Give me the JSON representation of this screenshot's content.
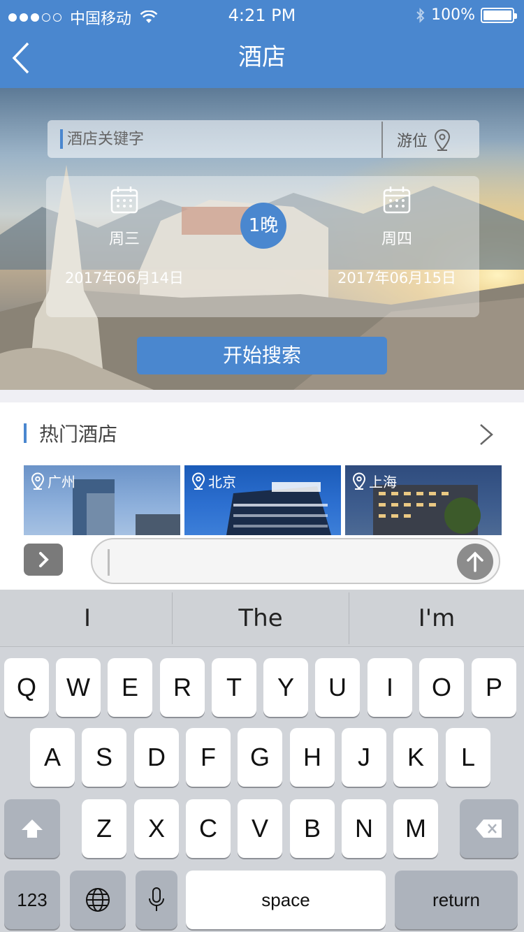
{
  "status_bar": {
    "carrier": "中国移动",
    "time": "4:21 PM",
    "battery": "100%",
    "battery_level": 1.0,
    "signal_bars_filled": 3,
    "signal_bars_total": 5
  },
  "nav": {
    "title": "酒店",
    "back_icon": "chevron-left-icon"
  },
  "search": {
    "placeholder": "酒店关键字",
    "location_label": "游位",
    "location_icon": "map-pin-icon"
  },
  "dates": {
    "checkin": {
      "weekday": "周三",
      "date": "2017年06月14日"
    },
    "checkout": {
      "weekday": "周四",
      "date": "2017年06月15日"
    },
    "nights": "1晚",
    "calendar_icon": "calendar-icon"
  },
  "search_button": "开始搜索",
  "hot_hotels": {
    "title": "热门酒店",
    "more_icon": "chevron-right-icon",
    "cities": [
      {
        "name": "广州"
      },
      {
        "name": "北京"
      },
      {
        "name": "上海"
      }
    ]
  },
  "chat_bar": {
    "expand_icon": "chevron-right-icon",
    "send_icon": "arrow-up-icon",
    "value": ""
  },
  "keyboard": {
    "suggestions": [
      "I",
      "The",
      "I'm"
    ],
    "row1": [
      "Q",
      "W",
      "E",
      "R",
      "T",
      "Y",
      "U",
      "I",
      "O",
      "P"
    ],
    "row2": [
      "A",
      "S",
      "D",
      "F",
      "G",
      "H",
      "J",
      "K",
      "L"
    ],
    "row3": [
      "Z",
      "X",
      "C",
      "V",
      "B",
      "N",
      "M"
    ],
    "numbers_label": "123",
    "space_label": "space",
    "return_label": "return",
    "shift_icon": "shift-arrow-icon",
    "delete_icon": "backspace-icon",
    "globe_icon": "globe-icon",
    "mic_icon": "microphone-icon"
  },
  "colors": {
    "brand_blue": "#4a87cf",
    "keyboard_bg": "#d1d4d9"
  }
}
